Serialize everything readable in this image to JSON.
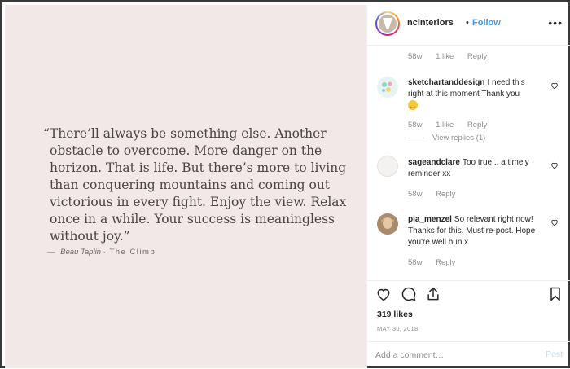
{
  "post_image": {
    "quote_lines": [
      "“There’ll always be something else. Another",
      "obstacle to overcome. More danger on the",
      "horizon. That is life. But there’s more to living",
      "than conquering mountains and coming out",
      "victorious in every fight. Enjoy the view. Relax",
      "once in a while. Your success is meaningless",
      "without joy.”"
    ],
    "attribution_dash": "—",
    "author": "Beau Taplin",
    "separator": "·",
    "book": "The Climb",
    "background_color": "#f2e8e8"
  },
  "header": {
    "username": "ncinteriors",
    "dot": "•",
    "follow_label": "Follow",
    "more_icon": "ellipsis-icon"
  },
  "comments": [
    {
      "meta_only": true,
      "time": "58w",
      "likes": "1 like",
      "reply_label": "Reply"
    },
    {
      "username": "sketchartanddesign",
      "text": "I need this right at this moment Thank you",
      "emoji": "grinning-face",
      "time": "58w",
      "likes": "1 like",
      "reply_label": "Reply",
      "view_replies": "View replies (1)",
      "avatar_color": "#dff2f0"
    },
    {
      "username": "sageandclare",
      "text": "Too true... a timely reminder xx",
      "time": "58w",
      "reply_label": "Reply",
      "avatar_color": "#f4f2f0"
    },
    {
      "username": "pia_menzel",
      "text": "So relevant right now! Thanks for this. Must re-post. Hope you're well hun x",
      "time": "58w",
      "reply_label": "Reply",
      "avatar_color": "#b89a7c"
    }
  ],
  "actions": {
    "icons": [
      "heart-icon",
      "comment-icon",
      "share-icon",
      "bookmark-icon"
    ],
    "likes": "319 likes",
    "date": "MAY 30, 2018"
  },
  "add_comment": {
    "placeholder": "Add a comment…",
    "post_label": "Post"
  }
}
